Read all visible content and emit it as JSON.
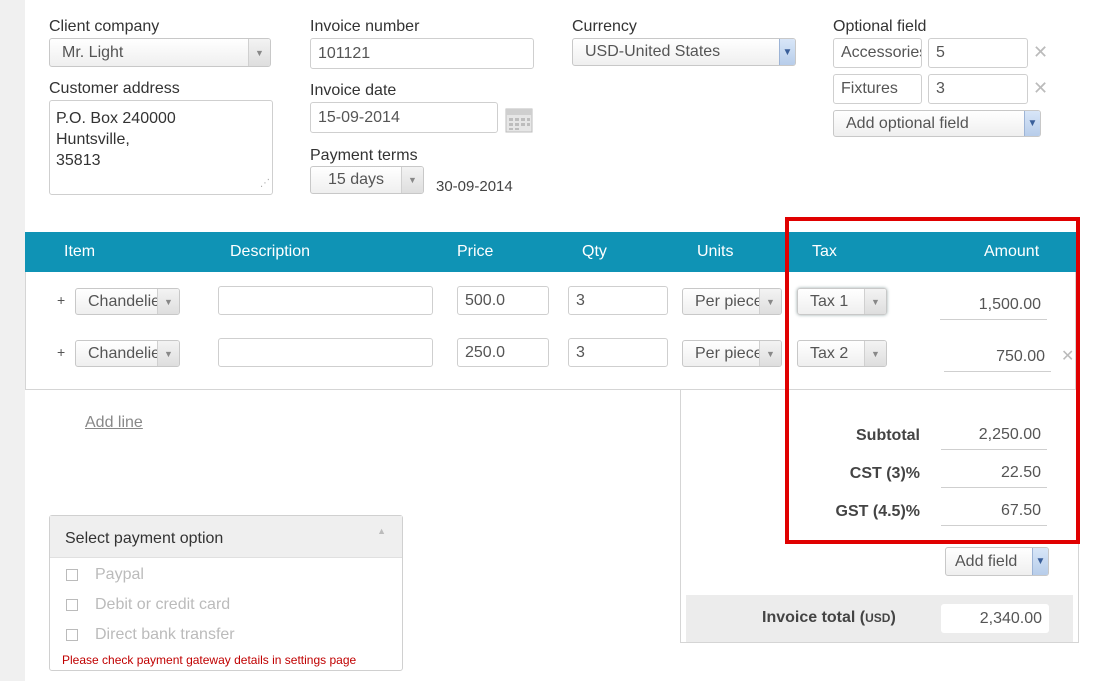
{
  "client": {
    "label": "Client company",
    "value": "Mr. Light",
    "address_label": "Customer address",
    "address_lines": [
      "P.O. Box 240000",
      "Huntsville,",
      "35813"
    ]
  },
  "invoice": {
    "number_label": "Invoice number",
    "number": "101121",
    "date_label": "Invoice date",
    "date": "15-09-2014",
    "terms_label": "Payment terms",
    "terms": "15 days",
    "due_date": "30-09-2014"
  },
  "currency": {
    "label": "Currency",
    "value": "USD-United States"
  },
  "optional": {
    "label": "Optional field",
    "fields": [
      {
        "name": "Accessories",
        "value": "5"
      },
      {
        "name": "Fixtures",
        "value": "3"
      }
    ],
    "add_label": "Add optional field"
  },
  "table": {
    "headers": {
      "item": "Item",
      "description": "Description",
      "price": "Price",
      "qty": "Qty",
      "units": "Units",
      "tax": "Tax",
      "amount": "Amount"
    },
    "rows": [
      {
        "plus": "+",
        "item": "Chandelier",
        "description": "",
        "price": "500.0",
        "qty": "3",
        "units": "Per piece",
        "tax": "Tax 1",
        "amount": "1,500.00"
      },
      {
        "plus": "+",
        "item": "Chandelier",
        "description": "",
        "price": "250.0",
        "qty": "3",
        "units": "Per piece",
        "tax": "Tax 2",
        "amount": "750.00"
      }
    ],
    "add_line": "Add line"
  },
  "summary": {
    "subtotal_label": "Subtotal",
    "subtotal": "2,250.00",
    "tax1_label": "CST (3)%",
    "tax1": "22.50",
    "tax2_label": "GST (4.5)%",
    "tax2": "67.50",
    "add_field": "Add field",
    "total_label": "Invoice total",
    "total_currency": "USD",
    "total": "2,340.00"
  },
  "payment": {
    "title": "Select payment option",
    "options": [
      "Paypal",
      "Debit or credit card",
      "Direct bank transfer"
    ],
    "warning": "Please check payment gateway details in settings page"
  },
  "colors": {
    "header_bg": "#0f93b5",
    "highlight": "#e00000",
    "warning": "#c00000"
  }
}
